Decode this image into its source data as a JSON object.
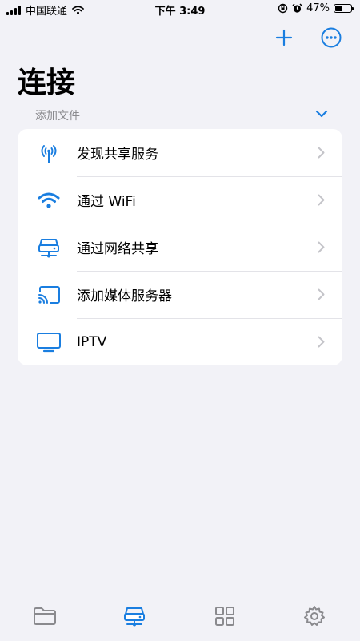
{
  "status_bar": {
    "carrier": "中国联通",
    "time": "下午 3:49",
    "battery": "47%"
  },
  "header": {
    "title": "连接",
    "add_icon": "plus-icon",
    "more_icon": "ellipsis-circle-icon"
  },
  "section": {
    "label": "添加文件",
    "toggle_icon": "chevron-down-icon"
  },
  "list": {
    "items": [
      {
        "label": "发现共享服务",
        "icon": "antenna-icon"
      },
      {
        "label": "通过 WiFi",
        "icon": "wifi-icon"
      },
      {
        "label": "通过网络共享",
        "icon": "network-server-icon"
      },
      {
        "label": "添加媒体服务器",
        "icon": "cast-icon"
      },
      {
        "label": "IPTV",
        "icon": "tv-icon"
      }
    ]
  },
  "tab_bar": {
    "tabs": [
      {
        "icon": "folder-icon",
        "active": false
      },
      {
        "icon": "network-server-icon",
        "active": true
      },
      {
        "icon": "grid-icon",
        "active": false
      },
      {
        "icon": "gear-icon",
        "active": false
      }
    ]
  },
  "colors": {
    "accent": "#1a7ee0",
    "background": "#f2f2f7",
    "inactive": "#8a8a8e"
  }
}
